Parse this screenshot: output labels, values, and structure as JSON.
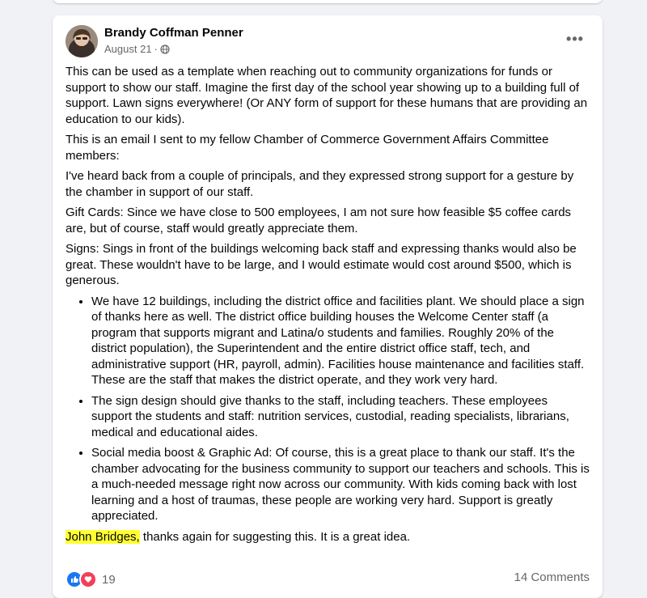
{
  "post": {
    "author": "Brandy Coffman Penner",
    "date": "August 21",
    "separator": "·",
    "more_label": "•••",
    "paragraphs": [
      "This can be used as a template when reaching out to community organizations for funds or support to show our staff. Imagine the first day of the school year showing up to a building full of support. Lawn signs everywhere! (Or ANY form of support for these humans that are providing an education to our kids).",
      "This is an email I sent to my fellow Chamber of Commerce Government Affairs Committee members:",
      "I've heard back from a couple of principals, and they expressed strong support for a gesture by the chamber in support of our staff.",
      "Gift Cards: Since we have close to 500 employees, I am not sure how feasible $5 coffee cards are, but of course, staff would greatly appreciate them.",
      "Signs: Sings in front of the buildings welcoming back staff and expressing thanks would also be great. These wouldn't have to be large, and I would estimate would cost around $500, which is generous."
    ],
    "bullets": [
      "We have 12 buildings, including the district office and facilities plant. We should place a sign of thanks here as well. The district office building houses the Welcome Center staff (a program that supports migrant and Latina/o students and families. Roughly 20% of the district population), the Superintendent and the entire district office staff, tech, and administrative support (HR, payroll, admin). Facilities house maintenance and facilities staff. These are the staff that makes the district operate, and they work very hard.",
      "The sign design should give thanks to the staff, including teachers. These employees support the students and staff: nutrition services, custodial, reading specialists, librarians, medical and educational aides.",
      "Social media boost & Graphic Ad: Of course, this is a great place to thank our staff. It's the chamber advocating for the business community to support our teachers and schools. This is a much-needed message right now across our community. With kids coming back with lost learning and a host of traumas, these people are working very hard. Support is greatly appreciated."
    ],
    "closing_mention": "John Bridges,",
    "closing_text": " thanks again for suggesting this. It is a great idea.",
    "reaction_count": "19",
    "comments_label": "14 Comments",
    "highlight_color": "#ffff33",
    "icons": [
      "globe-icon",
      "more-options-icon",
      "like-reaction-icon",
      "love-reaction-icon"
    ]
  }
}
